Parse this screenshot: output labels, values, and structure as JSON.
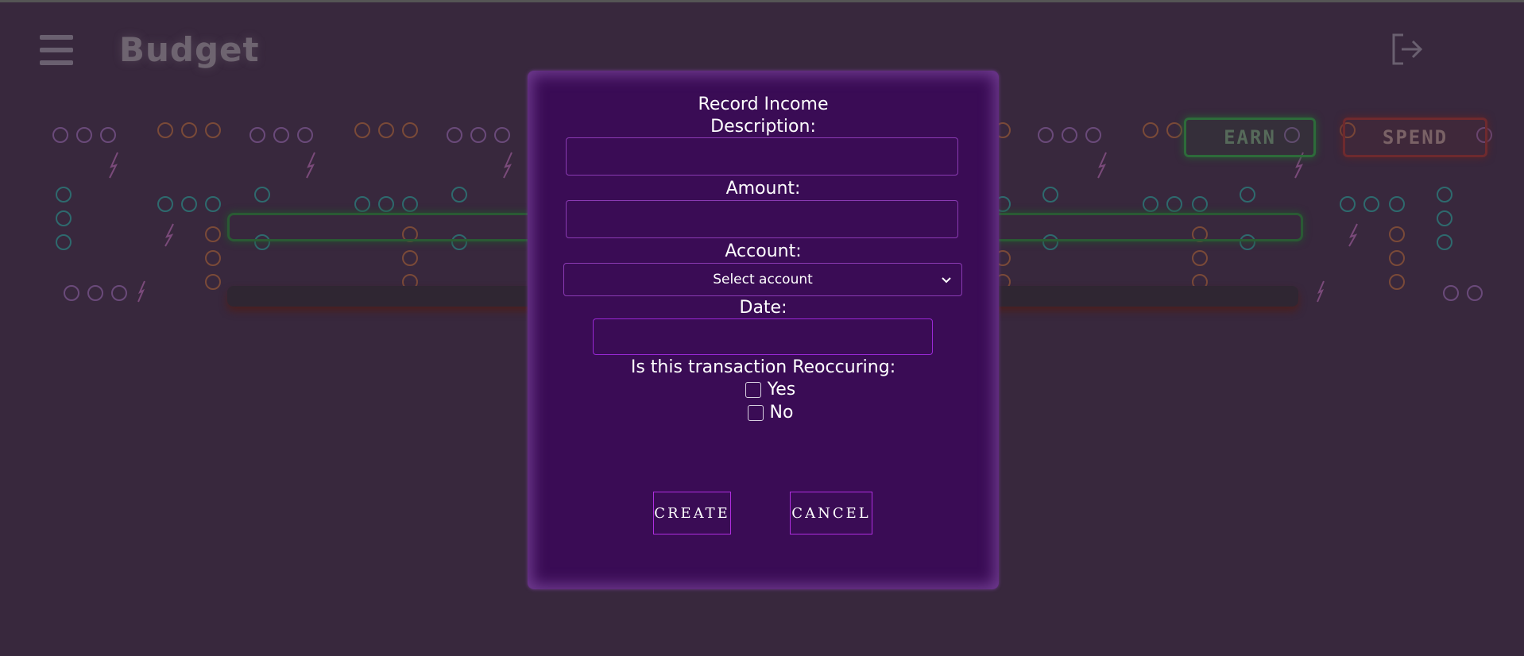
{
  "app": {
    "title": "Budget",
    "earn_label": "EARN",
    "spend_label": "SPEND"
  },
  "colors": {
    "background": "#38283d",
    "modal": "#3a0c55",
    "accent": "#b02ee0",
    "earn": "#2d6b3a",
    "spend": "#6e2a2e"
  },
  "modal": {
    "title": "Record Income",
    "description_label": "Description:",
    "description_value": "",
    "amount_label": "Amount:",
    "amount_value": "",
    "account_label": "Account:",
    "account_selected": "Select account",
    "date_label": "Date:",
    "date_value": "",
    "reoccurring_label": "Is this transaction Reoccuring:",
    "yes_label": "Yes",
    "no_label": "No",
    "yes_checked": false,
    "no_checked": false,
    "create_label": "CREATE",
    "cancel_label": "CANCEL"
  },
  "icons": {
    "menu": "hamburger-icon",
    "logout": "logout-icon",
    "chevron": "chevron-down-icon"
  }
}
